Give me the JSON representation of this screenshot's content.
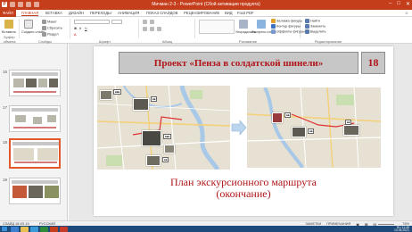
{
  "window": {
    "title": "Мичман 2-3 - PowerPoint (Сбой активации продукта)",
    "minimize": "–",
    "maximize": "□",
    "close": "✕"
  },
  "tabs": [
    {
      "label": "ФАЙЛ"
    },
    {
      "label": "ГЛАВНАЯ"
    },
    {
      "label": "ВСТАВКА"
    },
    {
      "label": "ДИЗАЙН"
    },
    {
      "label": "ПЕРЕХОДЫ"
    },
    {
      "label": "АНИМАЦИЯ"
    },
    {
      "label": "ПОКАЗ СЛАЙДОВ"
    },
    {
      "label": "РЕЦЕНЗИРОВАНИЕ"
    },
    {
      "label": "ВИД"
    },
    {
      "label": "Foxit PDF"
    }
  ],
  "ribbon": {
    "clipboard": {
      "label": "Буфер обмена",
      "paste": "Вставить"
    },
    "slides": {
      "label": "Слайды",
      "new_slide": "Создать слайд",
      "layout": "Макет",
      "reset": "Сбросить",
      "section": "Раздел"
    },
    "font": {
      "label": "Шрифт"
    },
    "paragraph": {
      "label": "Абзац"
    },
    "drawing": {
      "label": "Рисование",
      "arrange": "Упорядочить",
      "quick_styles": "Экспресс-стили",
      "fill": "Заливка фигуры",
      "outline": "Контур фигуры",
      "effects": "Эффекты фигуры"
    },
    "editing": {
      "label": "Редактирование",
      "find": "Найти",
      "replace": "Заменить",
      "select": "Выделить"
    }
  },
  "thumbnails": [
    {
      "num": "16"
    },
    {
      "num": "17"
    },
    {
      "num": "18"
    },
    {
      "num": "19"
    }
  ],
  "slide": {
    "title": "Проект «Пенза в солдатской шинели»",
    "number": "18",
    "caption_line1": "План экскурсионного маршрута",
    "caption_line2": "(окончание)"
  },
  "status": {
    "slide_info": "СЛАЙД 18 ИЗ 19",
    "language": "РУССКИЙ",
    "notes": "ЗАМЕТКИ",
    "comments": "ПРИМЕЧАНИЯ",
    "zoom": "76%"
  },
  "taskbar": {
    "language": "RU",
    "time": "11:45",
    "date": "10.06.2021"
  },
  "colors": {
    "accent": "#c43e1c",
    "banner_text": "#b0161b",
    "banner_bg": "#c7c7c7",
    "taskbar": "#1c4a7a"
  }
}
